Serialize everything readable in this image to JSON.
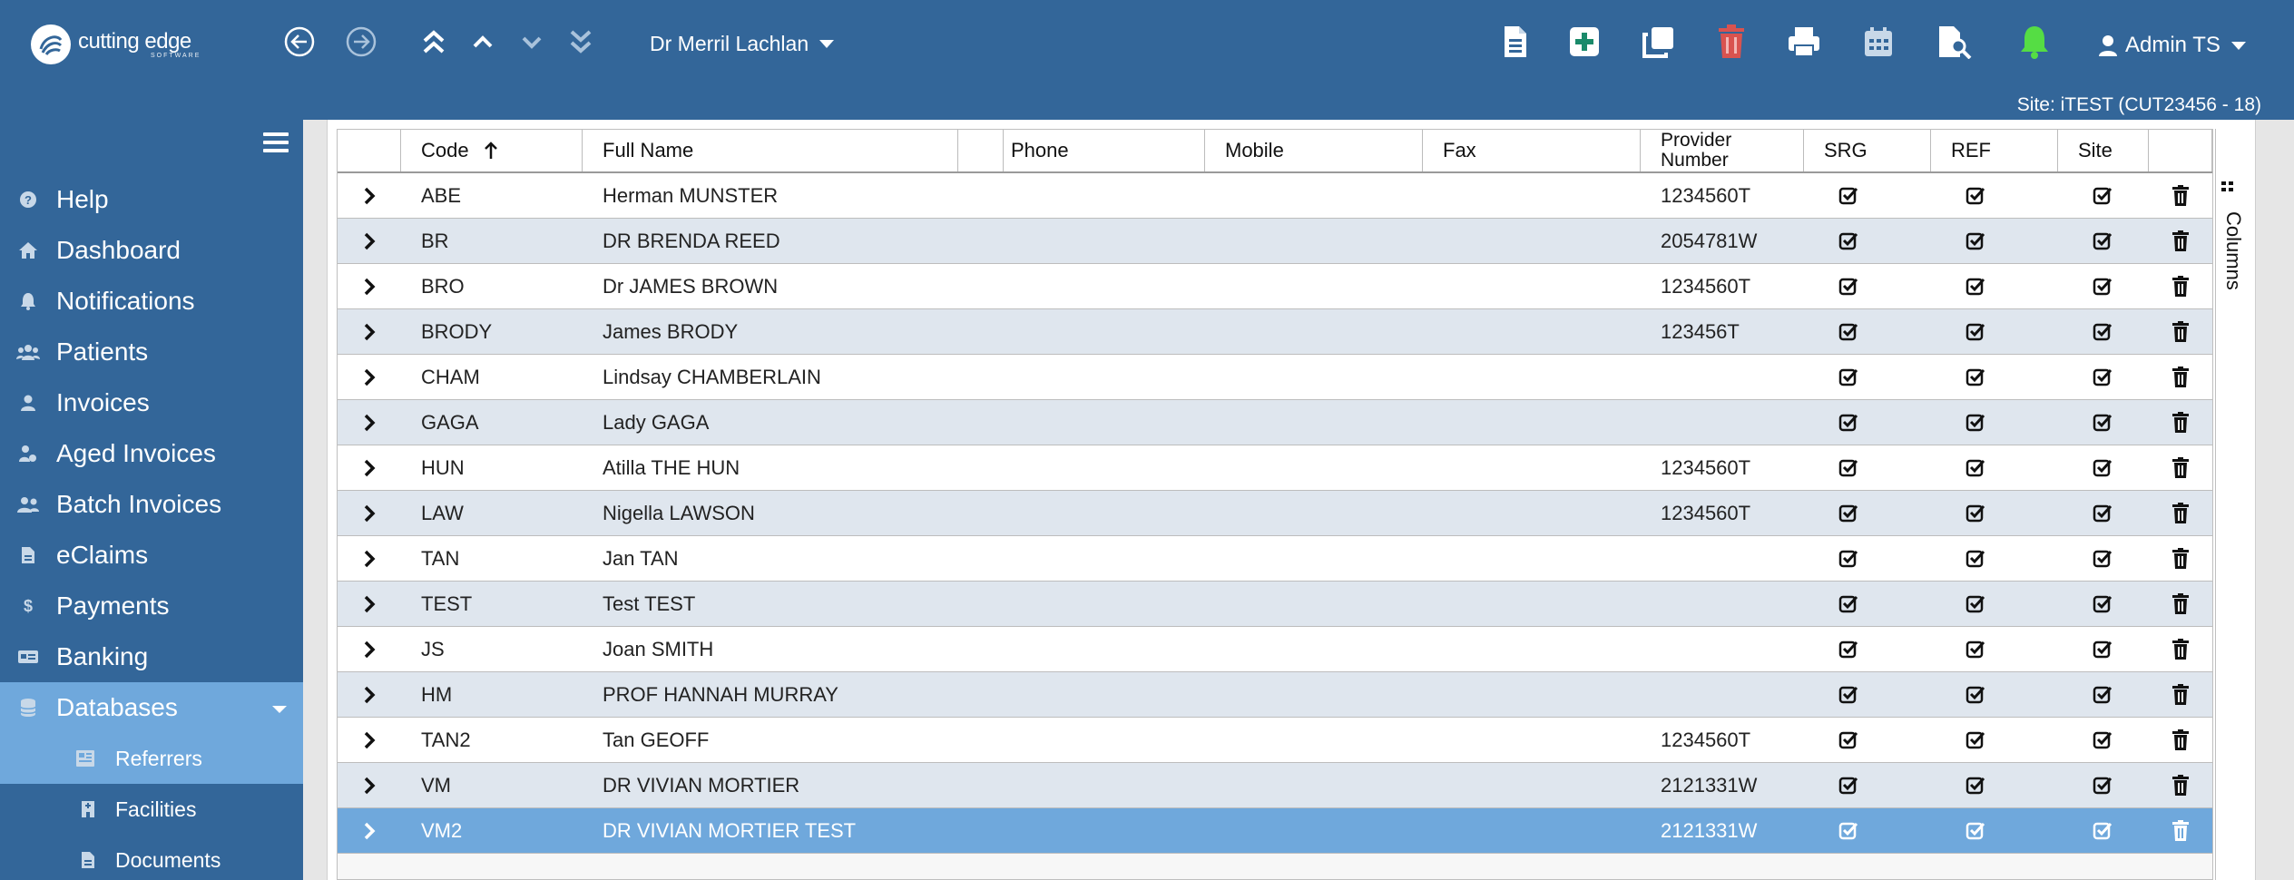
{
  "app": {
    "logo_name": "cutting edge",
    "logo_sub": "SOFTWARE"
  },
  "topbar": {
    "provider": "Dr Merril Lachlan",
    "user": "Admin TS",
    "icons": [
      "arrow-left-circle-icon",
      "arrow-right-circle-icon",
      "double-chevron-up-icon",
      "chevron-up-icon",
      "chevron-down-icon",
      "double-chevron-down-icon",
      "document-icon",
      "add-icon",
      "copy-icon",
      "trash-icon",
      "print-icon",
      "calendar-icon",
      "search-document-icon",
      "bell-icon",
      "user-icon"
    ],
    "colors": {
      "add": "#1a8a6a",
      "trash": "#d9534f",
      "bell": "#55dd44"
    }
  },
  "site": "Site: iTEST (CUT23456 - 18)",
  "sidebar": {
    "items": [
      {
        "label": "Help",
        "icon": "help-icon"
      },
      {
        "label": "Dashboard",
        "icon": "home-icon"
      },
      {
        "label": "Notifications",
        "icon": "bell-icon"
      },
      {
        "label": "Patients",
        "icon": "users-icon"
      },
      {
        "label": "Invoices",
        "icon": "user-icon"
      },
      {
        "label": "Aged Invoices",
        "icon": "user-clock-icon"
      },
      {
        "label": "Batch Invoices",
        "icon": "users-icon"
      },
      {
        "label": "eClaims",
        "icon": "file-icon"
      },
      {
        "label": "Payments",
        "icon": "dollar-icon"
      },
      {
        "label": "Banking",
        "icon": "card-icon"
      },
      {
        "label": "Databases",
        "icon": "database-icon",
        "active": true
      }
    ],
    "subitems": [
      {
        "label": "Referrers",
        "icon": "address-book-icon",
        "active": true
      },
      {
        "label": "Facilities",
        "icon": "hospital-icon"
      },
      {
        "label": "Documents",
        "icon": "file-text-icon"
      }
    ]
  },
  "grid": {
    "columns": {
      "code": "Code",
      "full_name": "Full Name",
      "phone": "Phone",
      "mobile": "Mobile",
      "fax": "Fax",
      "provider_l1": "Provider",
      "provider_l2": "Number",
      "srg": "SRG",
      "ref": "REF",
      "site": "Site"
    },
    "columns_panel": "Columns",
    "rows": [
      {
        "code": "ABE",
        "name": "Herman MUNSTER",
        "provider": "1234560T"
      },
      {
        "code": "BR",
        "name": "DR BRENDA REED",
        "provider": "2054781W"
      },
      {
        "code": "BRO",
        "name": "Dr JAMES BROWN",
        "provider": "1234560T"
      },
      {
        "code": "BRODY",
        "name": "James BRODY",
        "provider": "123456T"
      },
      {
        "code": "CHAM",
        "name": "Lindsay CHAMBERLAIN",
        "provider": ""
      },
      {
        "code": "GAGA",
        "name": "Lady GAGA",
        "provider": ""
      },
      {
        "code": "HUN",
        "name": "Atilla THE HUN",
        "provider": "1234560T"
      },
      {
        "code": "LAW",
        "name": "Nigella LAWSON",
        "provider": "1234560T"
      },
      {
        "code": "TAN",
        "name": "Jan TAN",
        "provider": ""
      },
      {
        "code": "TEST",
        "name": "Test TEST",
        "provider": ""
      },
      {
        "code": "JS",
        "name": "Joan SMITH",
        "provider": ""
      },
      {
        "code": "HM",
        "name": "PROF HANNAH MURRAY",
        "provider": ""
      },
      {
        "code": "TAN2",
        "name": "Tan GEOFF",
        "provider": "1234560T"
      },
      {
        "code": "VM",
        "name": "DR VIVIAN MORTIER",
        "provider": "2121331W"
      },
      {
        "code": "VM2",
        "name": "DR VIVIAN MORTIER TEST",
        "provider": "2121331W",
        "selected": true
      }
    ]
  }
}
